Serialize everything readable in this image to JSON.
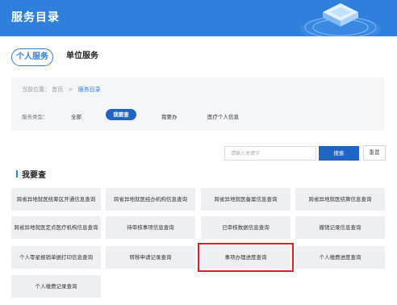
{
  "header": {
    "title": "服务目录"
  },
  "tabs": [
    "个人服务",
    "单位服务"
  ],
  "breadcrumb": {
    "prefix": "当前位置：",
    "home": "首页",
    "separator": ">",
    "current": "服务目录"
  },
  "filter": {
    "label": "服务类型：",
    "options": [
      "全部",
      "我要查",
      "我要办",
      "医疗个人信息"
    ],
    "selected": "我要查"
  },
  "search": {
    "placeholder": "请输入关键字",
    "button": "搜索",
    "reset": "重置"
  },
  "section": {
    "title": "我要查"
  },
  "services": [
    "跨省异地就医统筹区开通信息查询",
    "跨省异地就医经办机构信息查询",
    "跨省异地就医备案信息查询",
    "跨省异地就医结算信息查询",
    "跨省异地就医定点医疗机构信息查询",
    "待审核事项信息查询",
    "已审核数据信息查询",
    "撤销记录信息查询",
    "个人零星报销单据打印信息查询",
    "转移申请记录查询",
    "事项办理进度查询",
    "个人缴费进度查询",
    "个人缴费记录查询"
  ],
  "highlighted_service": "事项办理进度查询",
  "colors": {
    "brand": "#2f7fdc",
    "button": "#2065c4",
    "card_bg": "#eeeff2",
    "highlight": "#e02020"
  }
}
